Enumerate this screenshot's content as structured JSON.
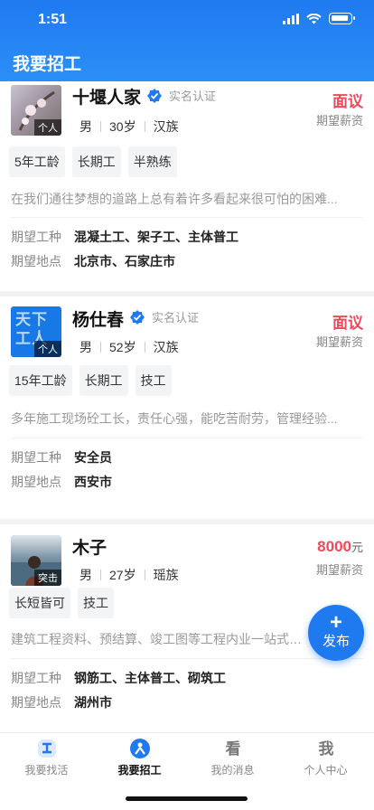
{
  "status_bar": {
    "time": "1:51"
  },
  "header": {
    "title": "我要招工"
  },
  "workers": [
    {
      "name": "十堰人家",
      "verified_label": "实名认证",
      "avatar_tag": "个人",
      "gender": "男",
      "age": "30岁",
      "ethnicity": "汉族",
      "salary": "面议",
      "salary_unit": "",
      "salary_label": "期望薪资",
      "tags": [
        "5年工龄",
        "长期工",
        "半熟练"
      ],
      "description": "在我们通往梦想的道路上总有着许多看起来很可怕的困难...",
      "job_label": "期望工种",
      "job_value": "混凝土工、架子工、主体普工",
      "location_label": "期望地点",
      "location_value": "北京市、石家庄市"
    },
    {
      "name": "杨仕春",
      "verified_label": "实名认证",
      "avatar_tag": "个人",
      "avatar_text": "天下工人",
      "gender": "男",
      "age": "52岁",
      "ethnicity": "汉族",
      "salary": "面议",
      "salary_unit": "",
      "salary_label": "期望薪资",
      "tags": [
        "15年工龄",
        "长期工",
        "技工"
      ],
      "description": "多年施工现场砼工长，责任心强，能吃苦耐劳，管理经验...",
      "job_label": "期望工种",
      "job_value": "安全员",
      "location_label": "期望地点",
      "location_value": "西安市"
    },
    {
      "name": "木子",
      "avatar_tag": "突击",
      "gender": "男",
      "age": "27岁",
      "ethnicity": "瑶族",
      "salary": "8000",
      "salary_unit": "元",
      "salary_label": "期望薪资",
      "tags": [
        "长短皆可",
        "技工"
      ],
      "description": "建筑工程资料、预结算、竣工图等工程内业一站式服务",
      "job_label": "期望工种",
      "job_value": "钢筋工、主体普工、砌筑工",
      "location_label": "期望地点",
      "location_value": "湖州市"
    }
  ],
  "fab": {
    "label": "发布"
  },
  "tabbar": {
    "items": [
      {
        "label": "我要找活",
        "active": false,
        "icon": "find-work-icon"
      },
      {
        "label": "我要招工",
        "active": true,
        "icon": "recruit-icon"
      },
      {
        "label": "我的消息",
        "active": false,
        "icon": "messages-icon"
      },
      {
        "label": "个人中心",
        "active": false,
        "icon": "profile-icon"
      }
    ]
  },
  "colors": {
    "primary": "#1f7af0",
    "salary": "#f04a5a"
  }
}
